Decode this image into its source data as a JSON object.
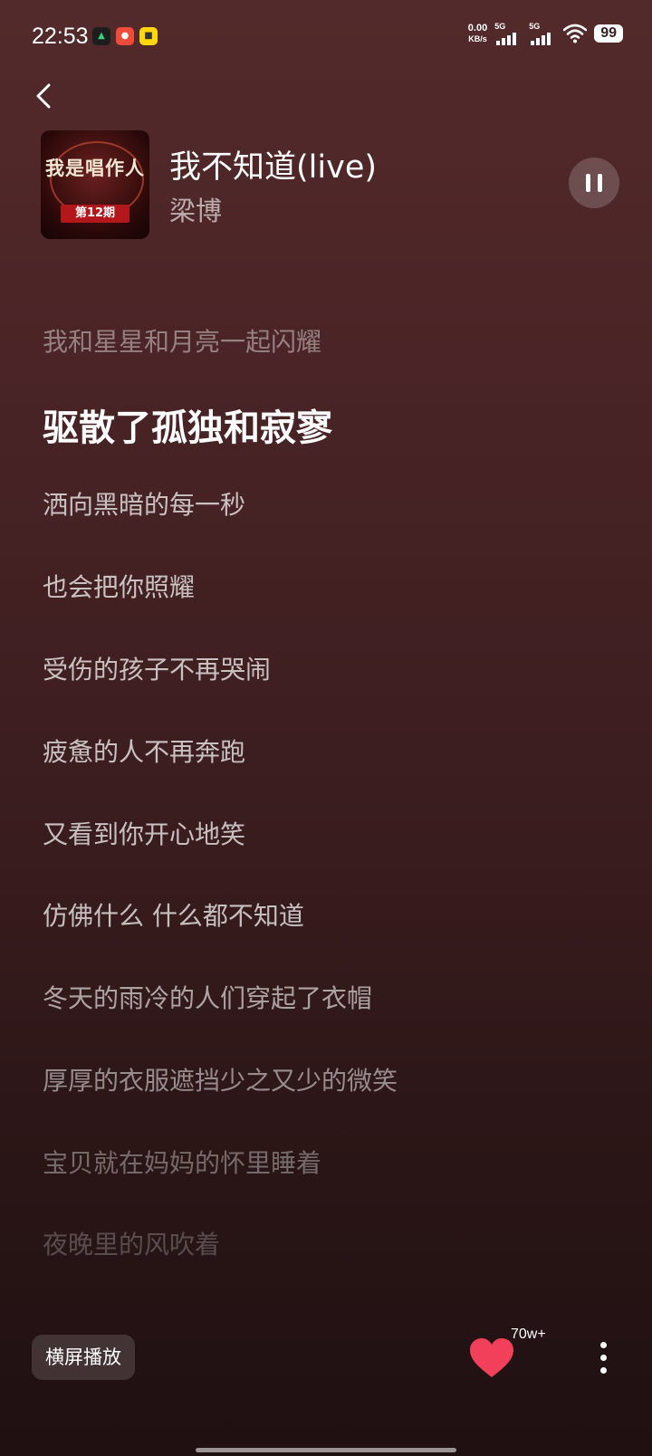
{
  "status_bar": {
    "time": "22:53",
    "net_speed_value": "0.00",
    "net_speed_unit": "KB/s",
    "signal1_label": "5G",
    "signal2_label": "5G",
    "battery": "99",
    "app_icons": [
      "小鹅通",
      "拼多多",
      "闲鱼"
    ]
  },
  "player": {
    "cover_title": "我是唱作人",
    "cover_badge": "第12期",
    "title": "我不知道(live)",
    "artist": "梁博"
  },
  "lyrics": {
    "lines": [
      "我和星星和月亮一起闪耀",
      "驱散了孤独和寂寥",
      "洒向黑暗的每一秒",
      "也会把你照耀",
      "受伤的孩子不再哭闹",
      "疲惫的人不再奔跑",
      "又看到你开心地笑",
      "仿佛什么 什么都不知道",
      "冬天的雨冷的人们穿起了衣帽",
      "厚厚的衣服遮挡少之又少的微笑",
      "宝贝就在妈妈的怀里睡着",
      "夜晚里的风吹着"
    ],
    "current_index": 1
  },
  "bottom_bar": {
    "landscape_label": "横屏播放",
    "like_count": "70w+"
  },
  "colors": {
    "accent_heart": "#f2405a",
    "background_top": "#532a2b",
    "background_bottom": "#1f1012"
  }
}
